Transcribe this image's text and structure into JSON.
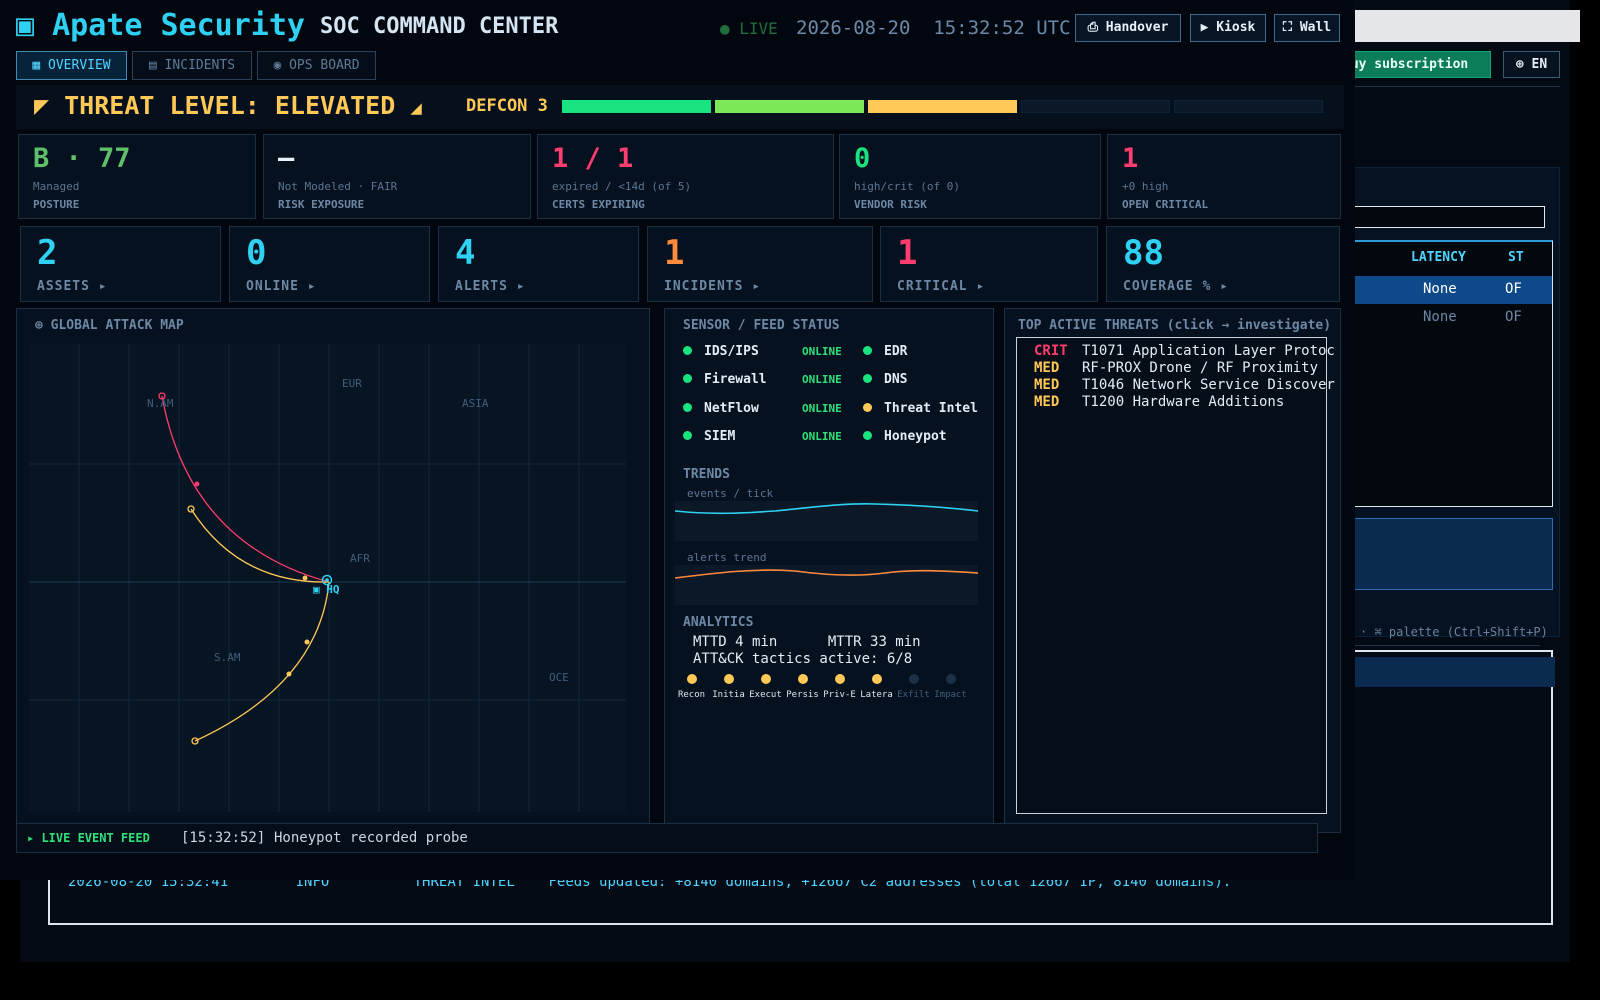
{
  "background": {
    "buy_label": "Buy subscription",
    "lang_label": "⊕ EN",
    "table_headers": [
      "LATENCY",
      "ST"
    ],
    "rows": [
      {
        "latency": "None",
        "status": "OF"
      },
      {
        "latency": "None",
        "status": "OF"
      }
    ],
    "palette_hint": "·  ⌘ palette (Ctrl+Shift+P)",
    "log_line": {
      "timestamp": "2026-08-20 15:32:41",
      "level": "INFO",
      "source": "THREAT INTEL",
      "message": "Feeds updated: +8140 domains, +12667 C2 addresses (total 12667 IP, 8140 domains)."
    }
  },
  "header": {
    "logo_icon": "▣",
    "app_name": "Apate Security",
    "subtitle": "SOC COMMAND CENTER",
    "live_label": "● LIVE",
    "date": "2026-08-20",
    "time": "15:32:52 UTC",
    "buttons": [
      {
        "icon": "⎙",
        "label": "Handover"
      },
      {
        "icon": "▶",
        "label": "Kiosk"
      },
      {
        "icon": "⛶",
        "label": "Wall"
      }
    ]
  },
  "tabs": [
    {
      "icon": "▦",
      "label": "OVERVIEW",
      "active": true
    },
    {
      "icon": "▤",
      "label": "INCIDENTS",
      "active": false
    },
    {
      "icon": "◉",
      "label": "OPS BOARD",
      "active": false
    }
  ],
  "threat": {
    "icon_left": "◤",
    "label": "THREAT LEVEL: ELEVATED",
    "icon_right": "◢",
    "defcon": "DEFCON 3",
    "level_filled": 3,
    "level_total": 5,
    "segment_colors": [
      "#19e37e",
      "#7be85a",
      "#ffc857",
      "#0a1828",
      "#0a1828"
    ]
  },
  "kpis": [
    {
      "value": "B · 77",
      "sub": "Managed",
      "caption": "POSTURE",
      "color": "#5fbf6b"
    },
    {
      "value": "—",
      "sub": "Not Modeled · FAIR",
      "caption": "RISK EXPOSURE",
      "color": "#e8f0f8"
    },
    {
      "value": "1 / 1",
      "sub": "expired / <14d  (of 5)",
      "caption": "CERTS EXPIRING",
      "color": "#ff3d6e"
    },
    {
      "value": "0",
      "sub": "high/crit  (of 0)",
      "caption": "VENDOR RISK",
      "color": "#19e37e"
    },
    {
      "value": "1",
      "sub": "+0 high",
      "caption": "OPEN CRITICAL",
      "color": "#ff3d6e"
    }
  ],
  "counters": [
    {
      "value": "2",
      "label": "ASSETS  ▸",
      "color": "#2ed1f2"
    },
    {
      "value": "0",
      "label": "ONLINE  ▸",
      "color": "#2ed1f2"
    },
    {
      "value": "4",
      "label": "ALERTS  ▸",
      "color": "#2ed1f2"
    },
    {
      "value": "1",
      "label": "INCIDENTS  ▸",
      "color": "#ff8a3d"
    },
    {
      "value": "1",
      "label": "CRITICAL  ▸",
      "color": "#ff3d6e"
    },
    {
      "value": "88",
      "label": "COVERAGE %  ▸",
      "color": "#2ed1f2"
    }
  ],
  "map": {
    "title": "⊕ GLOBAL ATTACK MAP",
    "regions": [
      "N.AM",
      "EUR",
      "ASIA",
      "AFR",
      "S.AM",
      "OCE"
    ],
    "hq_label": "▣ HQ"
  },
  "sensors": {
    "title": "SENSOR / FEED STATUS",
    "left": [
      {
        "name": "IDS/IPS",
        "status": "ONLINE"
      },
      {
        "name": "Firewall",
        "status": "ONLINE"
      },
      {
        "name": "NetFlow",
        "status": "ONLINE"
      },
      {
        "name": "SIEM",
        "status": "ONLINE"
      }
    ],
    "right": [
      {
        "name": "EDR",
        "dot_color": "#19e37e"
      },
      {
        "name": "DNS",
        "dot_color": "#19e37e"
      },
      {
        "name": "Threat Intel",
        "dot_color": "#ffc857"
      },
      {
        "name": "Honeypot",
        "dot_color": "#19e37e"
      }
    ],
    "trends_title": "TRENDS",
    "trend1_label": "events / tick",
    "trend2_label": "alerts trend",
    "analytics_title": "ANALYTICS",
    "mttd": "MTTD 4 min",
    "mttr": "MTTR 33 min",
    "tactics_active": "ATT&CK tactics active: 6/8",
    "tactics": [
      {
        "label": "Recon",
        "active": true
      },
      {
        "label": "Initia",
        "active": true
      },
      {
        "label": "Execut",
        "active": true
      },
      {
        "label": "Persis",
        "active": true
      },
      {
        "label": "Priv-E",
        "active": true
      },
      {
        "label": "Latera",
        "active": true
      },
      {
        "label": "Exfilt",
        "active": false
      },
      {
        "label": "Impact",
        "active": false
      }
    ]
  },
  "threats": {
    "title": "TOP ACTIVE THREATS  (click → investigate)",
    "items": [
      {
        "severity": "CRIT",
        "color": "#ff3d6e",
        "text": "T1071 Application Layer Protoc"
      },
      {
        "severity": "MED",
        "color": "#ffc857",
        "text": "RF-PROX Drone / RF Proximity"
      },
      {
        "severity": "MED",
        "color": "#ffc857",
        "text": "T1046 Network Service Discover"
      },
      {
        "severity": "MED",
        "color": "#ffc857",
        "text": "T1200 Hardware Additions"
      }
    ]
  },
  "feed": {
    "label": "▸ LIVE EVENT FEED",
    "time": "[15:32:52]",
    "message": "Honeypot recorded probe"
  }
}
